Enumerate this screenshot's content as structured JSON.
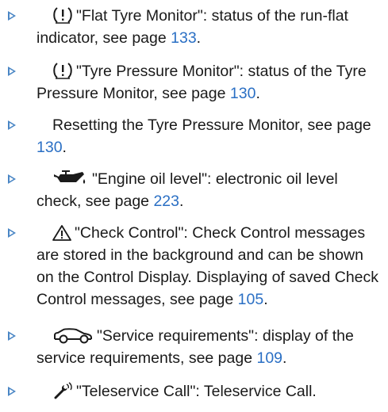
{
  "items": [
    {
      "icon": "tyre-warning-icon",
      "text": "\"Flat Tyre Monitor\": status of the run-flat indicator, see page",
      "page": "133",
      "tail": "."
    },
    {
      "icon": "tyre-warning-icon",
      "text": "\"Tyre Pressure Monitor\": status of the Tyre Pressure Monitor, see page",
      "page": "130",
      "tail": "."
    },
    {
      "icon": "",
      "text": "Resetting the Tyre Pressure Monitor, see page",
      "page": "130",
      "tail": "."
    },
    {
      "icon": "oil-can-icon",
      "text": "\"Engine oil level\": electronic oil level check, see page",
      "page": "223",
      "tail": "."
    },
    {
      "icon": "warning-triangle-icon",
      "text": "\"Check Control\": Check Control messages are stored in the background and can be shown on the Control Display. Displaying of saved Check Control messages, see page",
      "page": "105",
      "tail": "."
    },
    {
      "icon": "car-service-icon",
      "text": "\"Service requirements\": display of the service requirements, see page",
      "page": "109",
      "tail": "."
    },
    {
      "icon": "wrench-signal-icon",
      "text": "\"Teleservice Call\": Teleservice Call.",
      "page": "",
      "tail": ""
    }
  ],
  "colors": {
    "bullet": "#4a86c5",
    "link": "#2a6fc4",
    "text": "#1a1a1a"
  }
}
